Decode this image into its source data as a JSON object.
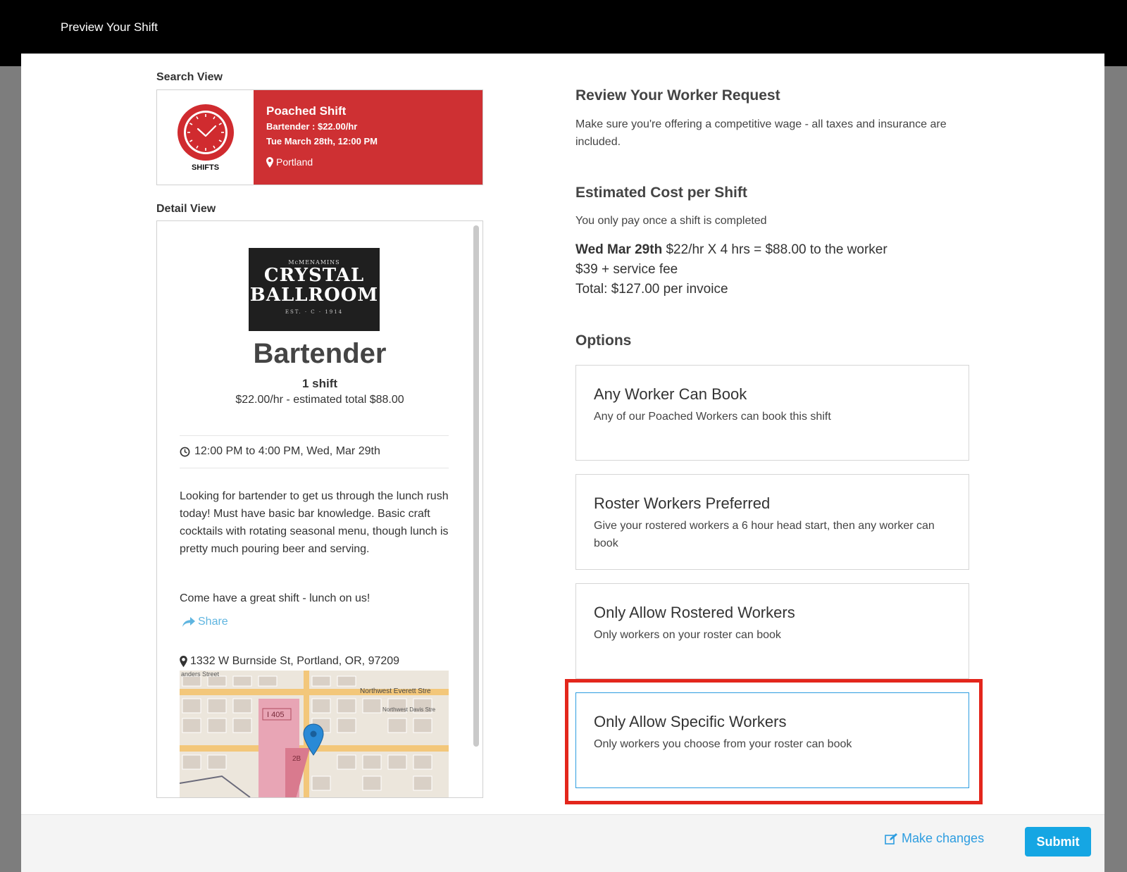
{
  "header": {
    "title": "Preview Your Shift"
  },
  "search_view": {
    "label": "Search View",
    "shifts_label": "SHIFTS",
    "title": "Poached Shift",
    "role_rate": "Bartender : $22.00/hr",
    "datetime": "Tue March 28th, 12:00 PM",
    "location": "Portland",
    "accent_color": "#ce3033"
  },
  "detail_view": {
    "label": "Detail View",
    "logo": {
      "top": "McMENAMINS",
      "line1": "CRYSTAL",
      "line2": "BALLROOM",
      "est": "EST. · C · 1914"
    },
    "job_title": "Bartender",
    "shift_count": "1 shift",
    "rate": "$22.00/hr - estimated total $88.00",
    "time": "12:00 PM to 4:00 PM, Wed, Mar 29th",
    "description": "Looking for bartender to get us through the lunch rush today! Must have basic bar knowledge. Basic craft cocktails with rotating seasonal menu, though lunch is pretty much pouring beer and serving.",
    "description2": "Come have a great shift - lunch on us!",
    "share_label": "Share",
    "address": "1332 W Burnside St, Portland, OR, 97209",
    "map_labels": {
      "street1": "anders Street",
      "street2": "Northwest Everett Stre",
      "street3": "Northwest Davis Stre",
      "highway": "I 405",
      "exit": "2B"
    }
  },
  "review": {
    "title": "Review Your Worker Request",
    "text": "Make sure you're offering a competitive wage - all taxes and insurance are included."
  },
  "cost": {
    "title": "Estimated Cost per Shift",
    "subtitle": "You only pay once a shift is completed",
    "date": "Wed Mar 29th",
    "calc": "$22/hr X 4 hrs = $88.00 to the worker",
    "fee": "$39 + service fee",
    "total": "Total: $127.00 per invoice"
  },
  "options": {
    "title": "Options",
    "items": [
      {
        "title": "Any Worker Can Book",
        "desc": "Any of our Poached Workers can book this shift"
      },
      {
        "title": "Roster Workers Preferred",
        "desc": "Give your rostered workers a 6 hour head start, then any worker can book"
      },
      {
        "title": "Only Allow Rostered Workers",
        "desc": "Only workers on your roster can book"
      },
      {
        "title": "Only Allow Specific Workers",
        "desc": "Only workers you choose from your roster can book"
      }
    ],
    "selected_color": "#2d9de0",
    "highlight_color": "#e3261c"
  },
  "footer": {
    "make_changes": "Make changes",
    "submit": "Submit"
  }
}
